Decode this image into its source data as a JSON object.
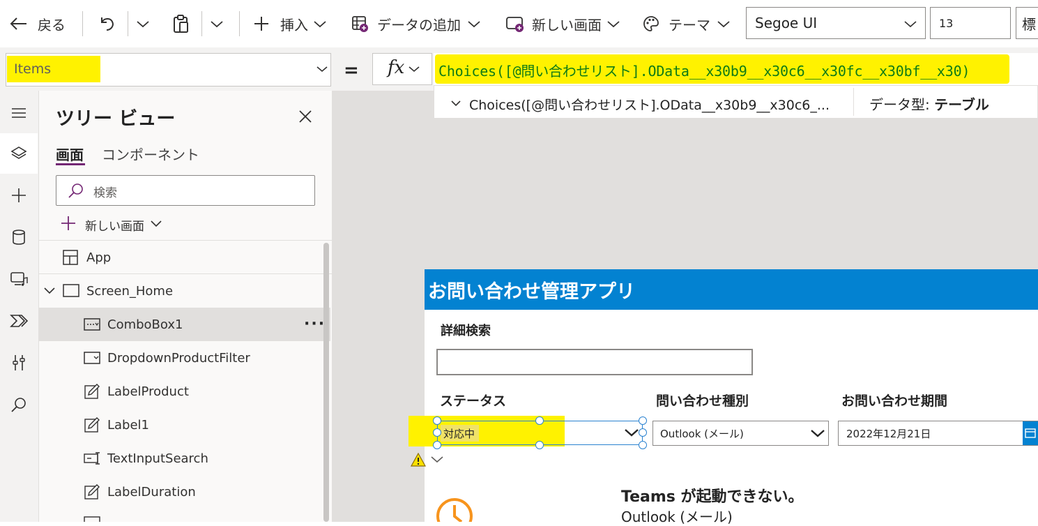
{
  "toolbar": {
    "back_label": "戻る",
    "insert_label": "挿入",
    "add_data_label": "データの追加",
    "new_screen_label": "新しい画面",
    "theme_label": "テーマ",
    "font_family_value": "Segoe UI",
    "font_size_value": "13",
    "font_weight_value": "標"
  },
  "formula_bar": {
    "property": "Items",
    "equals": "=",
    "fx": "fx",
    "formula": "Choices([@問い合わせリスト].OData__x30b9__x30c6__x30fc__x30bf__x30)",
    "result_preview": "Choices([@問い合わせリスト].OData__x30b9__x30c6_...",
    "data_type_label": "データ型:",
    "data_type_value": "テーブル"
  },
  "tree_view": {
    "title": "ツリー ビュー",
    "tabs": [
      "画面",
      "コンポーネント"
    ],
    "search_placeholder": "検索",
    "new_screen": "新しい画面",
    "items": [
      {
        "label": "App",
        "icon": "app-icon"
      },
      {
        "label": "Screen_Home",
        "icon": "screen-icon"
      },
      {
        "label": "ComboBox1",
        "icon": "combobox-icon",
        "selected": true
      },
      {
        "label": "DropdownProductFilter",
        "icon": "dropdown-icon"
      },
      {
        "label": "LabelProduct",
        "icon": "label-icon"
      },
      {
        "label": "Label1",
        "icon": "label-icon"
      },
      {
        "label": "TextInputSearch",
        "icon": "text-input-icon"
      },
      {
        "label": "LabelDuration",
        "icon": "label-icon"
      }
    ],
    "more": "···"
  },
  "app": {
    "title": "お問い合わせ管理アプリ",
    "detail_search_label": "詳細検索",
    "status_label": "ステータス",
    "type_label": "問い合わせ種別",
    "period_label": "お問い合わせ期間",
    "status_value": "対応中",
    "type_value": "Outlook (メール)",
    "date_value": "2022年12月21日",
    "item_title": "Teams が起動できない。",
    "item_subtitle": "Outlook (メール)"
  },
  "colors": {
    "highlight": "#fff200",
    "app_header": "#0382d1",
    "formula_text": "#0f7b16",
    "selection": "#2a82d0",
    "accent_tab": "#742774",
    "clock": "#f7941d"
  }
}
